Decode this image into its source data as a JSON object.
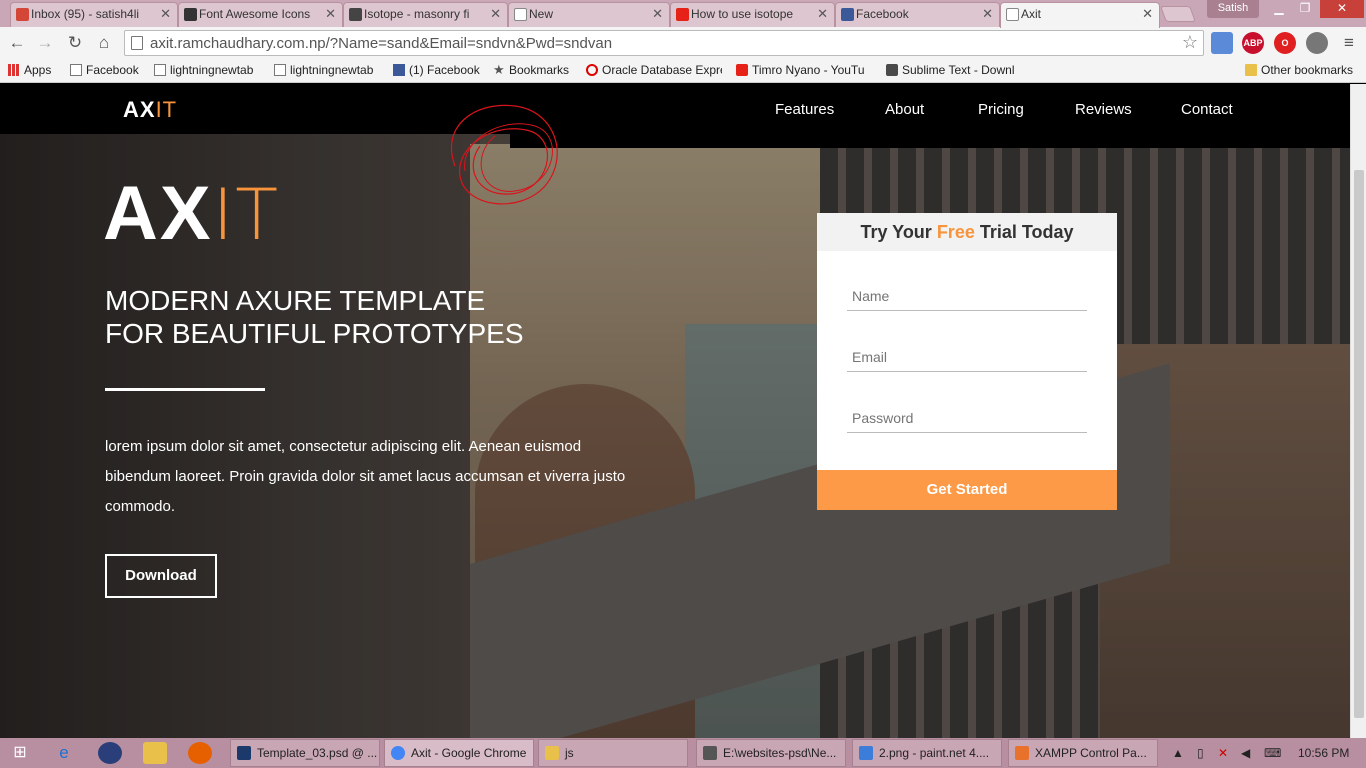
{
  "browser": {
    "tabs": [
      {
        "label": "Inbox (95) - satish4li",
        "icon_color": "#d44638",
        "icon": "gmail-icon"
      },
      {
        "label": "Font Awesome Icons",
        "icon_color": "#333333",
        "icon": "flag-icon"
      },
      {
        "label": "Isotope - masonry fi",
        "icon_color": "#444444",
        "icon": "isotope-icon"
      },
      {
        "label": "New",
        "icon_color": "#888888",
        "icon": "page-icon"
      },
      {
        "label": "How to use isotope",
        "icon_color": "#e62117",
        "icon": "youtube-icon"
      },
      {
        "label": "Facebook",
        "icon_color": "#3b5998",
        "icon": "facebook-icon"
      },
      {
        "label": "Axit",
        "icon_color": "#888888",
        "icon": "page-icon"
      }
    ],
    "user": "Satish",
    "url": "axit.ramchaudhary.com.np/?Name=sand&Email=sndvn&Pwd=sndvan",
    "bookmarks": [
      {
        "label": "Apps",
        "icon": "apps-icon"
      },
      {
        "label": "Facebook",
        "icon": "page-icon"
      },
      {
        "label": "lightningnewtab",
        "icon": "page-icon"
      },
      {
        "label": "lightningnewtab",
        "icon": "page-icon"
      },
      {
        "label": "(1) Facebook",
        "icon": "facebook-icon"
      },
      {
        "label": "Bookmarks",
        "icon": "star-icon"
      },
      {
        "label": "Oracle Database Expre",
        "icon": "oracle-icon"
      },
      {
        "label": "Timro Nyano - YouTu",
        "icon": "youtube-icon"
      },
      {
        "label": "Sublime Text - Downl",
        "icon": "sublime-icon"
      }
    ],
    "other_bookmarks": "Other bookmarks",
    "extensions": [
      "ABP"
    ]
  },
  "site": {
    "logo_main": "AX",
    "logo_accent": "IT",
    "nav": [
      "Features",
      "About",
      "Pricing",
      "Reviews",
      "Contact"
    ],
    "headline_line1": "MODERN AXURE TEMPLATE",
    "headline_line2": "FOR BEAUTIFUL PROTOTYPES",
    "body": "lorem ipsum dolor sit amet, consectetur adipiscing elit. Aenean euismod bibendum laoreet. Proin gravida dolor sit amet lacus accumsan et viverra justo commodo.",
    "download": "Download",
    "form": {
      "title_pre": "Try Your ",
      "title_free": "Free",
      "title_post": " Trial Today",
      "name_placeholder": "Name",
      "email_placeholder": "Email",
      "password_placeholder": "Password",
      "submit": "Get Started"
    },
    "accent_color": "#f7943c"
  },
  "taskbar": {
    "items": [
      {
        "label": "Template_03.psd @ ...",
        "icon_color": "#1b3a6b"
      },
      {
        "label": "Axit - Google Chrome",
        "icon_color": "#4285f4"
      },
      {
        "label": "js",
        "icon_color": "#e8c04a"
      },
      {
        "label": "E:\\websites-psd\\Ne...",
        "icon_color": "#555555"
      },
      {
        "label": "2.png - paint.net 4....",
        "icon_color": "#3b7dd8"
      },
      {
        "label": "XAMPP Control Pa...",
        "icon_color": "#e8712c"
      }
    ],
    "clock": "10:56 PM"
  }
}
